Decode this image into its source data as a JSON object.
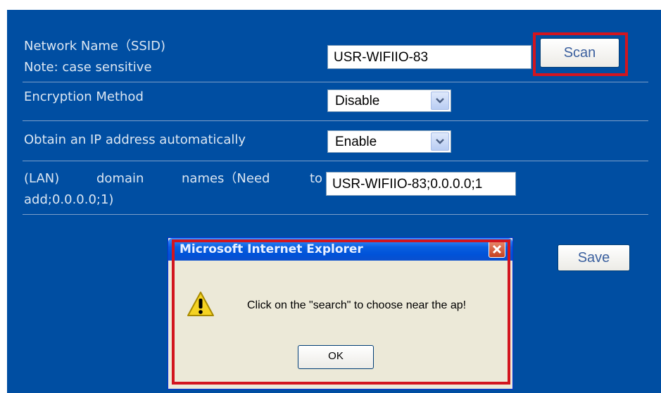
{
  "form": {
    "ssid": {
      "label": "Network Name（SSID)",
      "note": "Note: case sensitive",
      "value": "USR-WIFIIO-83",
      "scan_label": "Scan"
    },
    "encryption": {
      "label": "Encryption Method",
      "selected": "Disable"
    },
    "dhcp": {
      "label": "Obtain an IP address automatically",
      "selected": "Enable"
    },
    "lan": {
      "label_line1_a": "(LAN)",
      "label_line1_b": "domain",
      "label_line1_c": "names（Need",
      "label_line1_d": "to",
      "label_line2": "add;0.0.0.0;1)",
      "value": "USR-WIFIIO-83;0.0.0.0;1"
    },
    "save_label": "Save"
  },
  "dialog": {
    "title": "Microsoft Internet Explorer",
    "message": "Click on the \"search\" to choose near the ap!",
    "ok_label": "OK",
    "icon": "warning-icon"
  },
  "colors": {
    "panel": "#004EA2",
    "highlight": "#d2151f",
    "titlebar": "#0a5fe0"
  }
}
